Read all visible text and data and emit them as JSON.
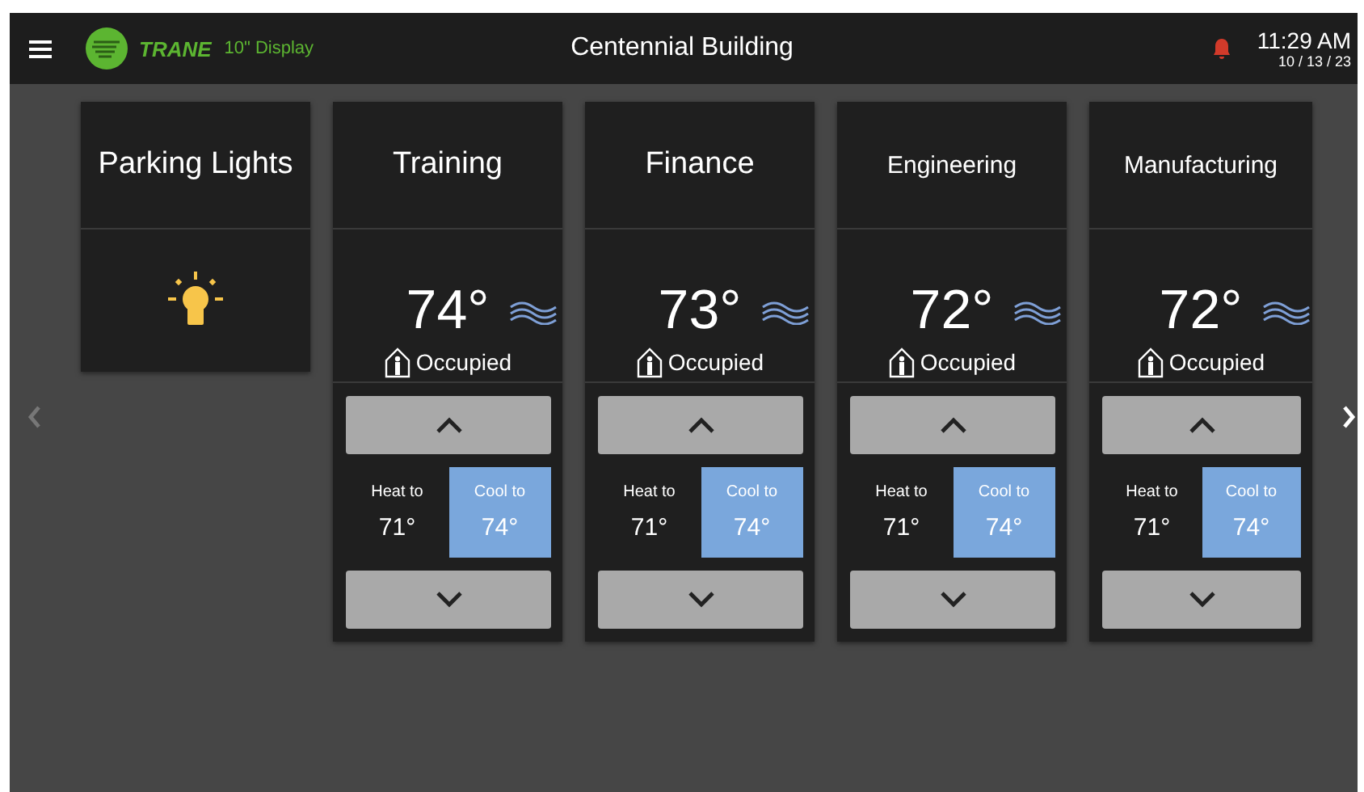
{
  "header": {
    "brand": "TRANE",
    "device": "10\" Display",
    "title": "Centennial Building",
    "alarm": true,
    "time": "11:29 AM",
    "date": "10 / 13 / 23"
  },
  "tiles": [
    {
      "kind": "light",
      "name": "Parking Lights",
      "on": true
    },
    {
      "kind": "zone",
      "name": "Training",
      "temperature": "74°",
      "status": "Occupied",
      "setpoints": [
        {
          "label": "Heat to",
          "value": "71°",
          "selected": false
        },
        {
          "label": "Cool to",
          "value": "74°",
          "selected": true
        }
      ]
    },
    {
      "kind": "zone",
      "name": "Finance",
      "temperature": "73°",
      "status": "Occupied",
      "setpoints": [
        {
          "label": "Heat to",
          "value": "71°",
          "selected": false
        },
        {
          "label": "Cool to",
          "value": "74°",
          "selected": true
        }
      ]
    },
    {
      "kind": "zone",
      "name": "Engineering",
      "temperature": "72°",
      "status": "Occupied",
      "setpoints": [
        {
          "label": "Heat to",
          "value": "71°",
          "selected": false
        },
        {
          "label": "Cool to",
          "value": "74°",
          "selected": true
        }
      ]
    },
    {
      "kind": "zone",
      "name": "Manufacturing",
      "temperature": "72°",
      "status": "Occupied",
      "setpoints": [
        {
          "label": "Heat to",
          "value": "71°",
          "selected": false
        },
        {
          "label": "Cool to",
          "value": "74°",
          "selected": true
        }
      ]
    }
  ]
}
